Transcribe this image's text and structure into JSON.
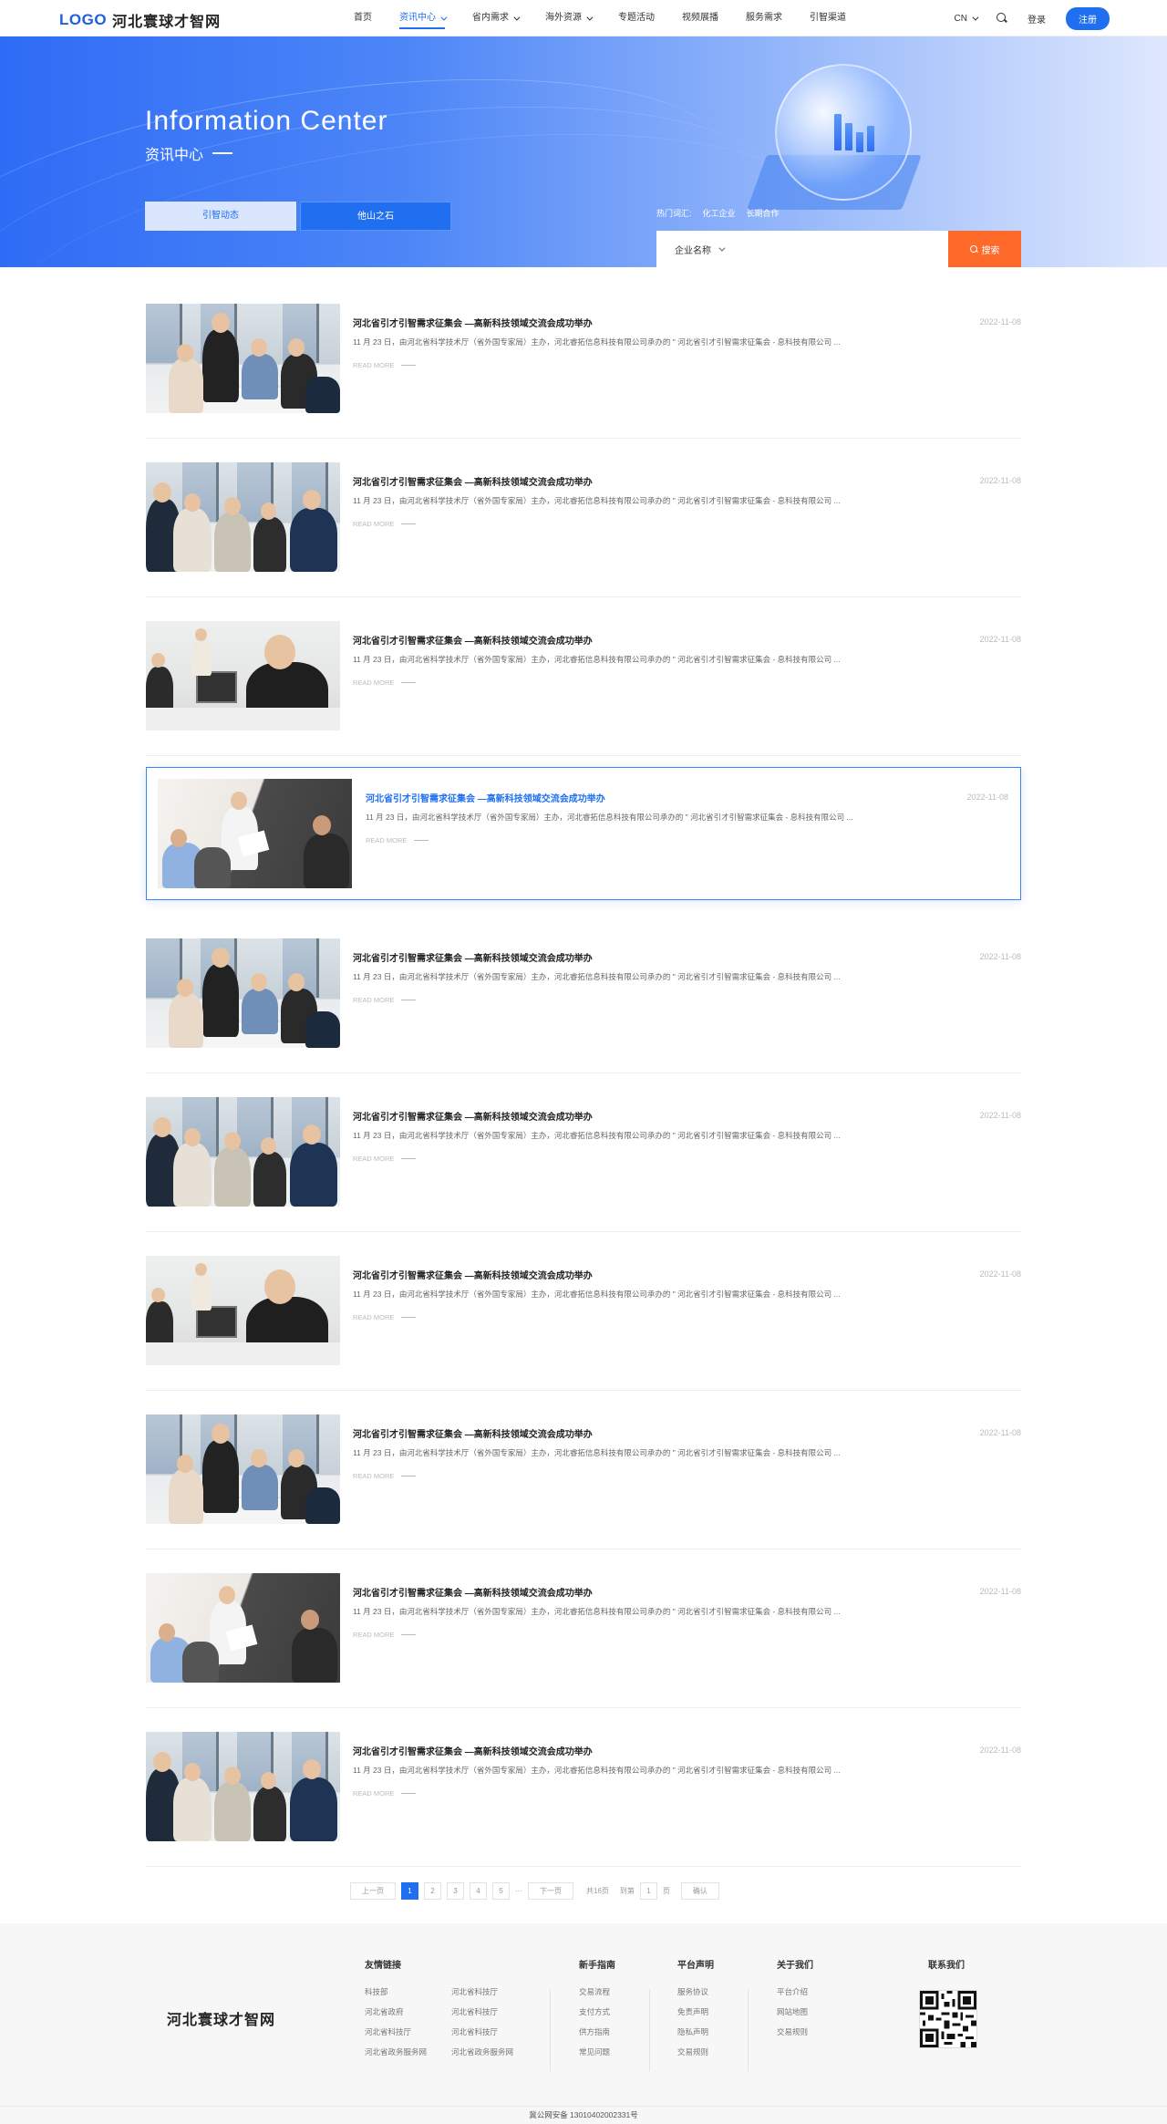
{
  "header": {
    "logo_mark": "LOGO",
    "logo_text": "河北寰球才智网",
    "nav": [
      {
        "label": "首页",
        "dropdown": false,
        "active": false
      },
      {
        "label": "资讯中心",
        "dropdown": true,
        "active": true
      },
      {
        "label": "省内需求",
        "dropdown": true,
        "active": false
      },
      {
        "label": "海外资源",
        "dropdown": true,
        "active": false
      },
      {
        "label": "专题活动",
        "dropdown": false,
        "active": false
      },
      {
        "label": "视频展播",
        "dropdown": false,
        "active": false
      },
      {
        "label": "服务需求",
        "dropdown": false,
        "active": false
      },
      {
        "label": "引智渠道",
        "dropdown": false,
        "active": false
      }
    ],
    "lang": "CN",
    "login": "登录",
    "register": "注册"
  },
  "banner": {
    "title_en": "Information Center",
    "title_cn": "资讯中心",
    "tabs": [
      "引智动态",
      "他山之石"
    ],
    "hotwords_label": "热门词汇:",
    "hotwords": [
      "化工企业",
      "长期合作"
    ],
    "search_select": "企业名称",
    "search_button": "搜索"
  },
  "news": {
    "read_more": "READ MORE",
    "items": [
      {
        "title": "河北省引才引智需求征集会 —高新科技领域交流会成功举办",
        "date": "2022-11-08",
        "summary": "11 月 23 日，由河北省科学技术厅（省外国专家局）主办，河北睿拓信息科技有限公司承办的 \" 河北省引才引智需求征集会 - 息科技有限公司 ..."
      },
      {
        "title": "河北省引才引智需求征集会 —高新科技领域交流会成功举办",
        "date": "2022-11-08",
        "summary": "11 月 23 日，由河北省科学技术厅（省外国专家局）主办，河北睿拓信息科技有限公司承办的 \" 河北省引才引智需求征集会 - 息科技有限公司 ..."
      },
      {
        "title": "河北省引才引智需求征集会 —高新科技领域交流会成功举办",
        "date": "2022-11-08",
        "summary": "11 月 23 日，由河北省科学技术厅（省外国专家局）主办，河北睿拓信息科技有限公司承办的 \" 河北省引才引智需求征集会 - 息科技有限公司 ..."
      },
      {
        "title": "河北省引才引智需求征集会 —高新科技领域交流会成功举办",
        "date": "2022-11-08",
        "summary": "11 月 23 日，由河北省科学技术厅（省外国专家局）主办，河北睿拓信息科技有限公司承办的 \" 河北省引才引智需求征集会 - 息科技有限公司 ..."
      },
      {
        "title": "河北省引才引智需求征集会 —高新科技领域交流会成功举办",
        "date": "2022-11-08",
        "summary": "11 月 23 日，由河北省科学技术厅（省外国专家局）主办，河北睿拓信息科技有限公司承办的 \" 河北省引才引智需求征集会 - 息科技有限公司 ..."
      },
      {
        "title": "河北省引才引智需求征集会 —高新科技领域交流会成功举办",
        "date": "2022-11-08",
        "summary": "11 月 23 日，由河北省科学技术厅（省外国专家局）主办，河北睿拓信息科技有限公司承办的 \" 河北省引才引智需求征集会 - 息科技有限公司 ..."
      },
      {
        "title": "河北省引才引智需求征集会 —高新科技领域交流会成功举办",
        "date": "2022-11-08",
        "summary": "11 月 23 日，由河北省科学技术厅（省外国专家局）主办，河北睿拓信息科技有限公司承办的 \" 河北省引才引智需求征集会 - 息科技有限公司 ..."
      },
      {
        "title": "河北省引才引智需求征集会 —高新科技领域交流会成功举办",
        "date": "2022-11-08",
        "summary": "11 月 23 日，由河北省科学技术厅（省外国专家局）主办，河北睿拓信息科技有限公司承办的 \" 河北省引才引智需求征集会 - 息科技有限公司 ..."
      },
      {
        "title": "河北省引才引智需求征集会 —高新科技领域交流会成功举办",
        "date": "2022-11-08",
        "summary": "11 月 23 日，由河北省科学技术厅（省外国专家局）主办，河北睿拓信息科技有限公司承办的 \" 河北省引才引智需求征集会 - 息科技有限公司 ..."
      },
      {
        "title": "河北省引才引智需求征集会 —高新科技领域交流会成功举办",
        "date": "2022-11-08",
        "summary": "11 月 23 日，由河北省科学技术厅（省外国专家局）主办，河北睿拓信息科技有限公司承办的 \" 河北省引才引智需求征集会 - 息科技有限公司 ..."
      }
    ]
  },
  "pager": {
    "prev": "上一页",
    "pages": [
      "1",
      "2",
      "3",
      "4",
      "5"
    ],
    "ellipsis": "···",
    "next": "下一页",
    "total": "共16页",
    "goto_label": "到第",
    "goto_value": "1",
    "page_unit": "页",
    "confirm": "确认"
  },
  "footer": {
    "logo_text": "河北寰球才智网",
    "friend_links_title": "友情链接",
    "friend_links": [
      "科技部",
      "河北省科技厅",
      "河北省政府",
      "河北省科技厅",
      "河北省科技厅",
      "河北省科技厅",
      "河北省政务服务网",
      "河北省政务服务网"
    ],
    "guide_title": "新手指南",
    "guide_links": [
      "交易流程",
      "支付方式",
      "供方指南",
      "常见问题"
    ],
    "statement_title": "平台声明",
    "statement_links": [
      "服务协议",
      "免责声明",
      "隐私声明",
      "交易规则"
    ],
    "about_title": "关于我们",
    "about_links": [
      "平台介绍",
      "网站地图",
      "交易规则"
    ],
    "contact_title": "联系我们",
    "icp": "冀公网安备 13010402002331号"
  },
  "colors": {
    "primary": "#1f6ff0",
    "search_button": "#ff6a2b"
  }
}
